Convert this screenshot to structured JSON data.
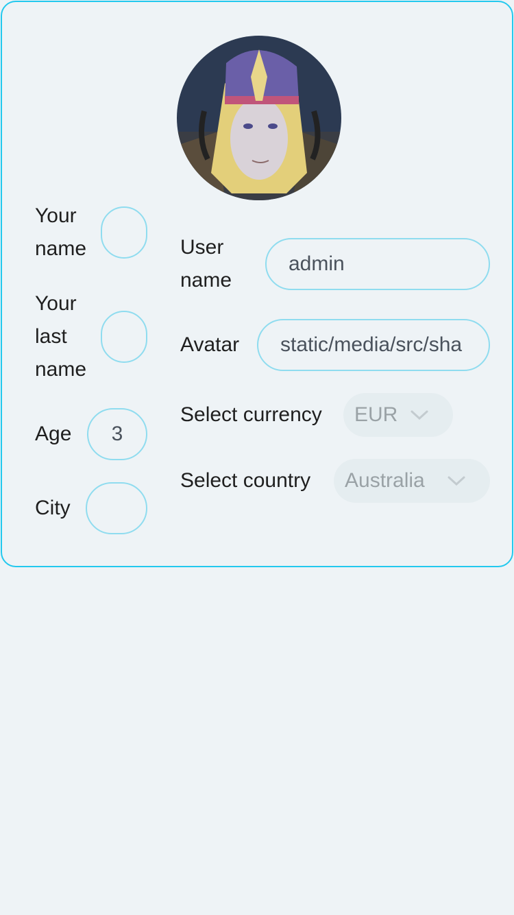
{
  "profile": {
    "avatar_icon": "avatar-image"
  },
  "left_form": {
    "first_name_label": "Your name",
    "first_name_value": "",
    "last_name_label": "Your last name",
    "last_name_value": "",
    "age_label": "Age",
    "age_value": "3",
    "city_label": "City",
    "city_value": ""
  },
  "right_form": {
    "username_label": "User name",
    "username_value": "admin",
    "avatar_label": "Avatar",
    "avatar_value": "static/media/src/sha",
    "currency_label": "Select currency",
    "currency_value": "EUR",
    "country_label": "Select country",
    "country_value": "Australia"
  },
  "colors": {
    "accent_border": "#22c8ee",
    "field_border": "#8fdcef",
    "background": "#eef3f6"
  }
}
